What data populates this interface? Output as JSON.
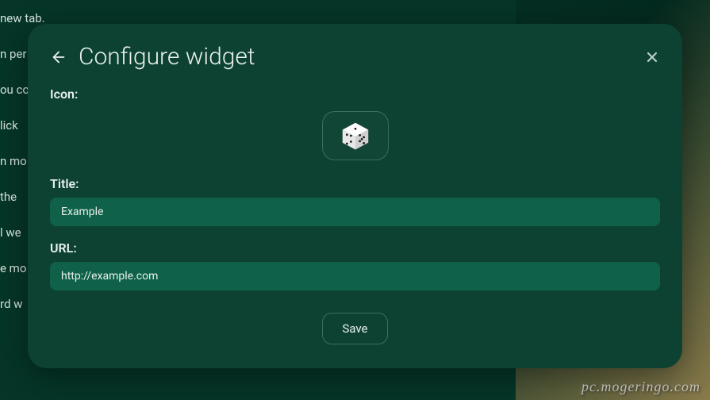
{
  "background": {
    "lines": [
      "new tab.",
      "n per",
      "ou co",
      "lick",
      "n mo",
      "the",
      "l we",
      "e mo",
      "rd w"
    ]
  },
  "modal": {
    "title": "Configure widget",
    "icon_label": "Icon:",
    "icon_name": "dice-icon",
    "title_label": "Title:",
    "title_value": "Example",
    "url_label": "URL:",
    "url_value": "http://example.com",
    "save_label": "Save"
  },
  "watermark": "pc.mogeringo.com"
}
